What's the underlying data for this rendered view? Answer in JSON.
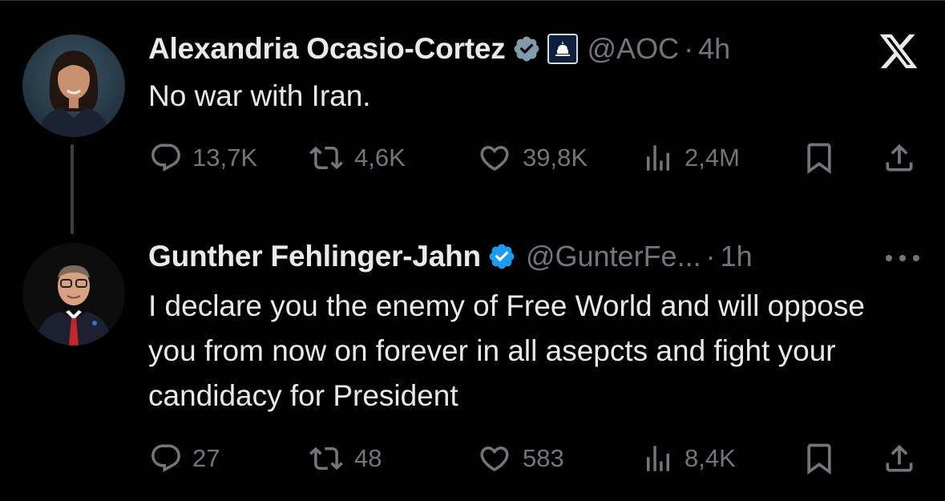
{
  "brand": {
    "platform_icon": "x-logo-icon"
  },
  "tweets": [
    {
      "author": {
        "name": "Alexandria Ocasio-Cortez",
        "handle": "@AOC",
        "verified": true,
        "affiliation_icon": "house-democrats-capitol-badge-icon"
      },
      "separator": "·",
      "time": "4h",
      "text": "No war with Iran.",
      "stats": {
        "replies": "13,7K",
        "reposts": "4,6K",
        "likes": "39,8K",
        "views": "2,4M"
      }
    },
    {
      "author": {
        "name": "Gunther Fehlinger-Jahn",
        "handle": "@GunterFe...",
        "verified": true
      },
      "separator": "·",
      "time": "1h",
      "text": "I declare you the enemy of Free World and will oppose you from now on forever in all asepcts and fight your candidacy for President",
      "stats": {
        "replies": "27",
        "reposts": "48",
        "likes": "583",
        "views": "8,4K"
      }
    }
  ],
  "colors": {
    "background": "#000000",
    "text": "#e7e9ea",
    "muted": "#71767b",
    "verified": "#1d9bf0",
    "verified_gray": "#829aab"
  }
}
